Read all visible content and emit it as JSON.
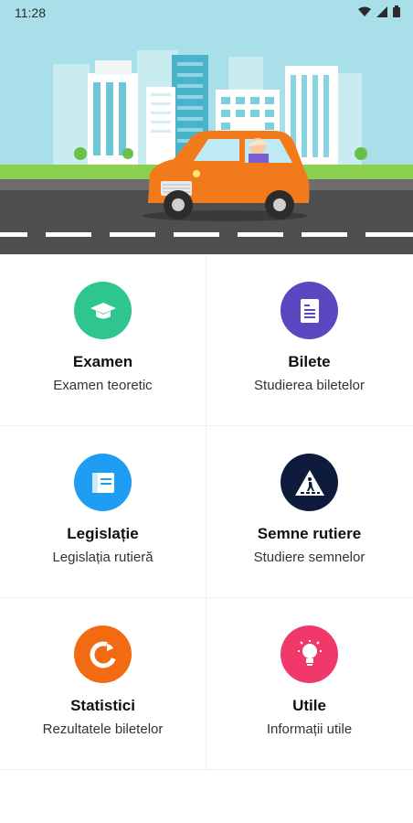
{
  "status_bar": {
    "time": "11:28"
  },
  "menu": [
    {
      "title": "Examen",
      "subtitle": "Examen teoretic",
      "icon": "graduation-cap-icon",
      "color": "#2fc58f"
    },
    {
      "title": "Bilete",
      "subtitle": "Studierea biletelor",
      "icon": "document-icon",
      "color": "#5948c0"
    },
    {
      "title": "Legislație",
      "subtitle": "Legislația rutieră",
      "icon": "book-icon",
      "color": "#1e9df2"
    },
    {
      "title": "Semne rutiere",
      "subtitle": "Studiere semnelor",
      "icon": "pedestrian-crossing-sign-icon",
      "color": "#0f1b3d"
    },
    {
      "title": "Statistici",
      "subtitle": "Rezultatele biletelor",
      "icon": "pie-chart-icon",
      "color": "#f26a12"
    },
    {
      "title": "Utile",
      "subtitle": "Informații utile",
      "icon": "lightbulb-icon",
      "color": "#f0386b"
    }
  ]
}
